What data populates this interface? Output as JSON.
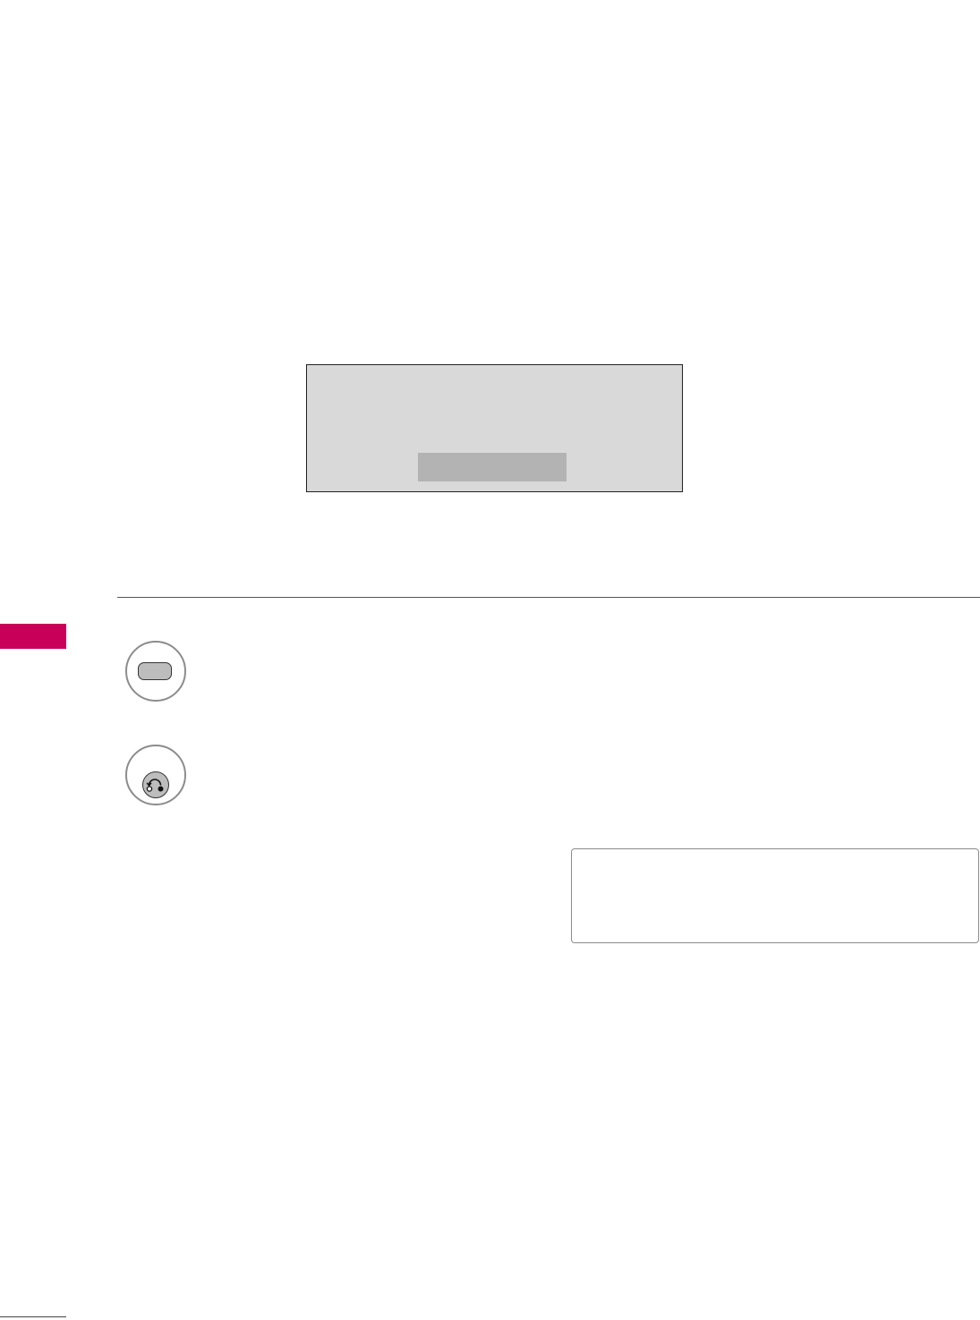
{
  "colors": {
    "section_tab": "#c9005a",
    "dialog_background": "#d9d9d9",
    "dialog_bar": "#b3b3b3",
    "button_fill": "#bdbdbd",
    "circle_border": "#8c8c8c"
  },
  "screen_dialog": {
    "bar_icon": "dialog-highlight-bar"
  },
  "steps": [
    {
      "icon": "remote-oval-button-icon"
    },
    {
      "icon": "remote-return-button-icon"
    }
  ]
}
